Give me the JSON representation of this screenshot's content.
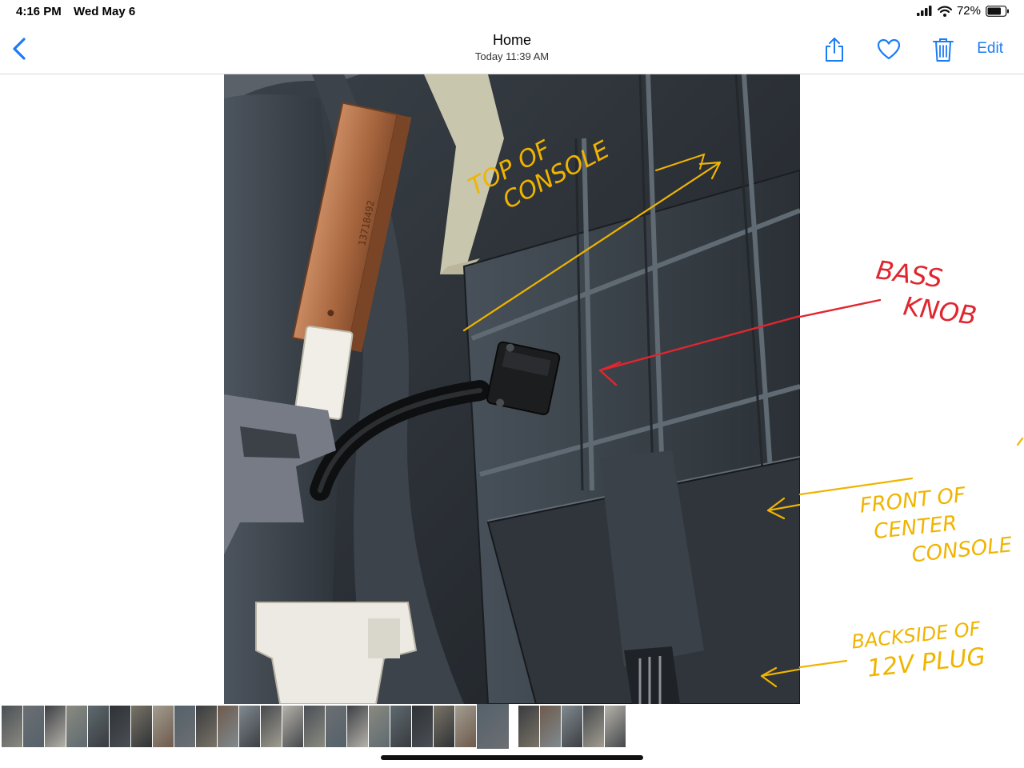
{
  "status": {
    "time": "4:16 PM",
    "date": "Wed May 6",
    "battery": "72%"
  },
  "nav": {
    "title": "Home",
    "subtitle": "Today  11:39 AM",
    "edit_label": "Edit"
  },
  "photo": {
    "part_number": "13718492",
    "annotations": {
      "top_line1": "TOP OF",
      "top_line2": "CONSOLE",
      "bass_line1": "BASS",
      "bass_line2": "KNOB",
      "front_line1": "FRONT OF",
      "front_line2": "CENTER",
      "front_line3": "CONSOLE",
      "back_line1": "BACKSIDE OF",
      "back_line2": "12V PLUG"
    }
  },
  "colors": {
    "accent": "#1a7cf5",
    "annot_yellow": "#f0b400",
    "annot_red": "#e0262f"
  },
  "thumbnails": {
    "count": 28,
    "selected_index": 22
  }
}
